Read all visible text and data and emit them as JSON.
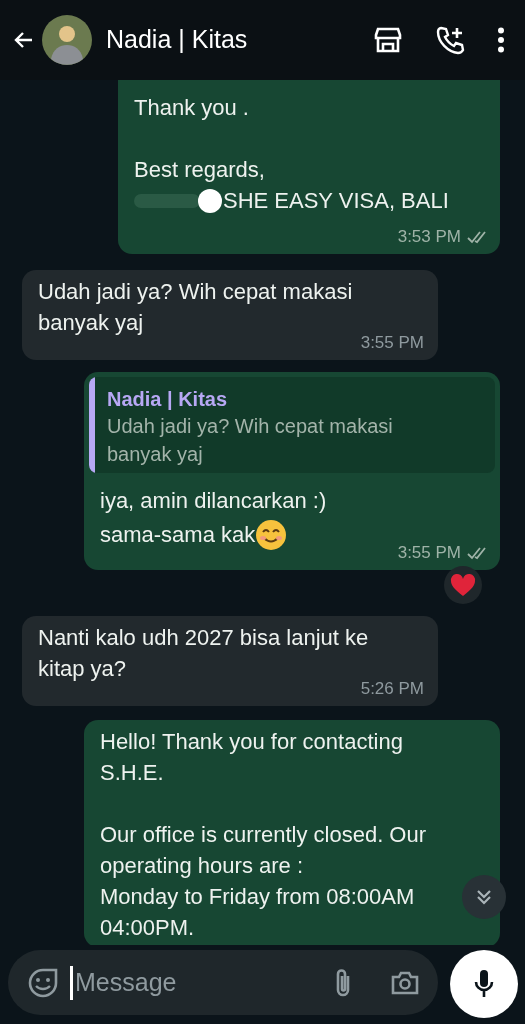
{
  "header": {
    "title": "Nadia | Kitas"
  },
  "messages": [
    {
      "kind": "outgoing",
      "paragraphs": [
        [
          {
            "text": "Thank you .",
            "redacted": false
          }
        ],
        [
          {
            "text": "Best regards,",
            "redacted": false
          },
          {
            "text": "SHE EASY VISA, BALI",
            "redacted": true
          }
        ]
      ],
      "time": "3:53 PM",
      "double_tick": true
    },
    {
      "kind": "incoming",
      "paragraphs": [
        [
          {
            "text": "Udah jadi ya? Wih cepat makasi",
            "redacted": false
          },
          {
            "text": "banyak yaj",
            "redacted": false
          }
        ]
      ],
      "time": "3:55 PM"
    },
    {
      "kind": "outgoing",
      "quote": {
        "author": "Nadia | Kitas",
        "color": "#b7a8f4",
        "lines": [
          "Udah jadi ya? Wih cepat makasi",
          "banyak yaj"
        ]
      },
      "paragraphs": [
        [
          {
            "text": "iya, amin dilancarkan :)",
            "redacted": false
          },
          {
            "text": "sama-sama kak",
            "redacted": false,
            "smiley": true
          }
        ]
      ],
      "time": "3:55 PM",
      "double_tick": true,
      "heart_reaction": true
    },
    {
      "kind": "incoming",
      "paragraphs": [
        [
          {
            "text": "Nanti kalo udh 2027 bisa lanjut ke",
            "redacted": false
          },
          {
            "text": "kitap ya?",
            "redacted": false
          }
        ]
      ],
      "time": "5:26 PM"
    },
    {
      "kind": "outgoing",
      "paragraphs": [
        [
          {
            "text": "Hello! Thank you for contacting",
            "redacted": false
          },
          {
            "text": "S.H.E.",
            "redacted": false
          }
        ],
        [
          {
            "text": "Our office is currently closed. Our",
            "redacted": false
          },
          {
            "text": "operating hours are :",
            "redacted": false
          },
          {
            "text": "Monday to Friday from 08:00AM",
            "redacted": false
          },
          {
            "text": "04:00PM.",
            "redacted": false
          }
        ]
      ]
    }
  ],
  "composer": {
    "placeholder": "Message"
  }
}
